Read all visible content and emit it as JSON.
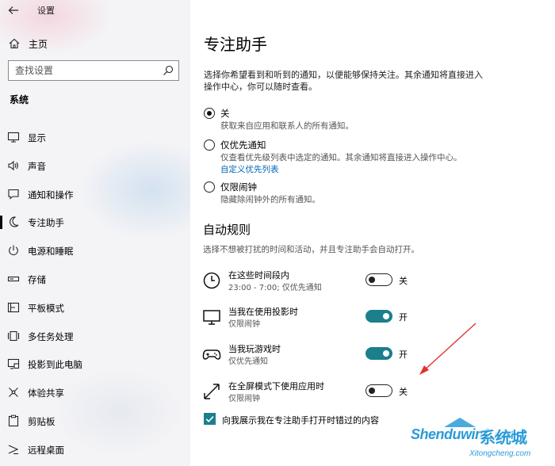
{
  "app": {
    "title": "设置"
  },
  "sidebar": {
    "home_label": "主页",
    "search_placeholder": "查找设置",
    "section_label": "系统",
    "items": [
      {
        "label": "显示",
        "icon": "monitor-icon"
      },
      {
        "label": "声音",
        "icon": "speaker-icon"
      },
      {
        "label": "通知和操作",
        "icon": "notification-icon"
      },
      {
        "label": "专注助手",
        "icon": "moon-icon",
        "active": true
      },
      {
        "label": "电源和睡眠",
        "icon": "power-icon"
      },
      {
        "label": "存储",
        "icon": "storage-icon"
      },
      {
        "label": "平板模式",
        "icon": "tablet-icon"
      },
      {
        "label": "多任务处理",
        "icon": "multitask-icon"
      },
      {
        "label": "投影到此电脑",
        "icon": "project-icon"
      },
      {
        "label": "体验共享",
        "icon": "share-icon"
      },
      {
        "label": "剪贴板",
        "icon": "clipboard-icon"
      },
      {
        "label": "远程桌面",
        "icon": "remote-icon"
      }
    ]
  },
  "main": {
    "title": "专注助手",
    "description": "选择你希望看到和听到的通知，以便能够保持关注。其余通知将直接进入操作中心，你可以随时查看。",
    "options": [
      {
        "label": "关",
        "sub": "获取来自应用和联系人的所有通知。",
        "checked": true
      },
      {
        "label": "仅优先通知",
        "sub": "仅查看优先级列表中选定的通知。其余通知将直接进入操作中心。",
        "link": "自定义优先列表",
        "checked": false
      },
      {
        "label": "仅限闹钟",
        "sub": "隐藏除闹钟外的所有通知。",
        "checked": false
      }
    ],
    "auto_rules": {
      "title": "自动规则",
      "description": "选择不想被打扰的时间和活动，并且专注助手会自动打开。",
      "rules": [
        {
          "title": "在这些时间段内",
          "meta": "23:00 - 7:00; 仅优先通知",
          "icon": "clock-icon",
          "on": false,
          "state_label": "关"
        },
        {
          "title": "当我在使用投影时",
          "meta": "仅限闹钟",
          "icon": "monitor-icon",
          "on": true,
          "state_label": "开"
        },
        {
          "title": "当我玩游戏时",
          "meta": "仅优先通知",
          "icon": "gamepad-icon",
          "on": true,
          "state_label": "开"
        },
        {
          "title": "在全屏模式下使用应用时",
          "meta": "仅限闹钟",
          "icon": "fullscreen-icon",
          "on": false,
          "state_label": "关"
        }
      ]
    },
    "summary_checkbox": {
      "label": "向我展示我在专注助手打开时错过的内容",
      "checked": true
    }
  },
  "watermark": {
    "brand": "Shenduwin8.com",
    "cn": "系统城",
    "sub": "Xitongcheng.com"
  },
  "colors": {
    "accent": "#1b7f8c",
    "link": "#0067b8",
    "annotation_arrow": "#e0342f"
  }
}
